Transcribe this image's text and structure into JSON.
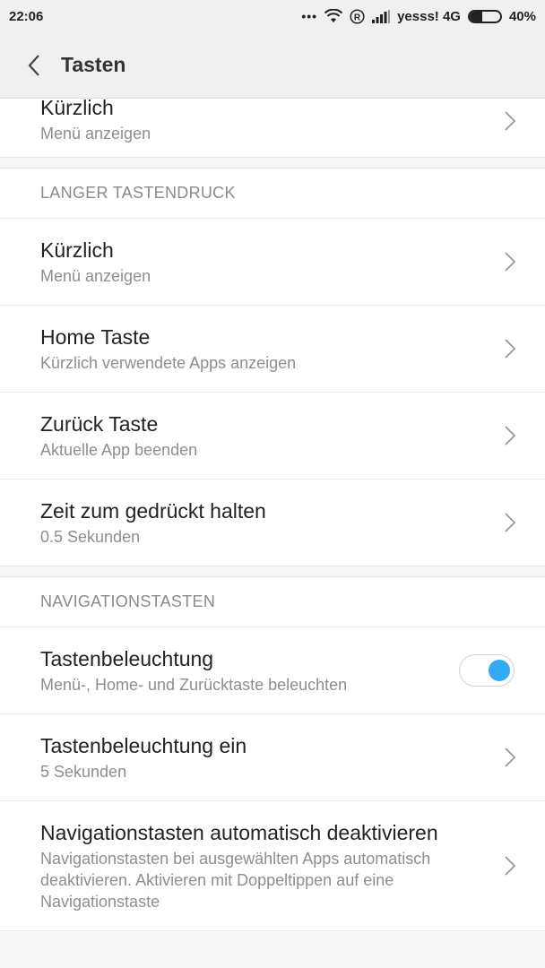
{
  "status": {
    "time": "22:06",
    "carrier": "yesss! 4G",
    "battery_label": "40%",
    "battery_level": 0.4
  },
  "header": {
    "title": "Tasten",
    "back_icon": "back-arrow-icon"
  },
  "sections": [
    {
      "header": "",
      "items": [
        {
          "title": "Kürzlich",
          "subtitle": "Menü anzeigen",
          "control": "chevron"
        }
      ]
    },
    {
      "header": "LANGER TASTENDRUCK",
      "items": [
        {
          "title": "Kürzlich",
          "subtitle": "Menü anzeigen",
          "control": "chevron"
        },
        {
          "title": "Home Taste",
          "subtitle": "Kürzlich verwendete Apps anzeigen",
          "control": "chevron"
        },
        {
          "title": "Zurück Taste",
          "subtitle": "Aktuelle App beenden",
          "control": "chevron"
        },
        {
          "title": "Zeit zum gedrückt halten",
          "subtitle": "0.5 Sekunden",
          "control": "chevron"
        }
      ]
    },
    {
      "header": "NAVIGATIONSTASTEN",
      "items": [
        {
          "title": "Tastenbeleuchtung",
          "subtitle": "Menü-, Home- und Zurücktaste beleuchten",
          "control": "toggle",
          "toggle_on": true
        },
        {
          "title": "Tastenbeleuchtung ein",
          "subtitle": "5 Sekunden",
          "control": "chevron"
        },
        {
          "title": "Navigationstasten automatisch deaktivieren",
          "subtitle": "Navigationstasten bei ausgewählten Apps automatisch deaktivieren. Aktivieren mit Doppeltippen auf eine Navigationstaste",
          "control": "chevron"
        }
      ]
    }
  ],
  "colors": {
    "toggle_accent": "#33aaf5",
    "background": "#f7f7f7",
    "card": "#ffffff"
  }
}
